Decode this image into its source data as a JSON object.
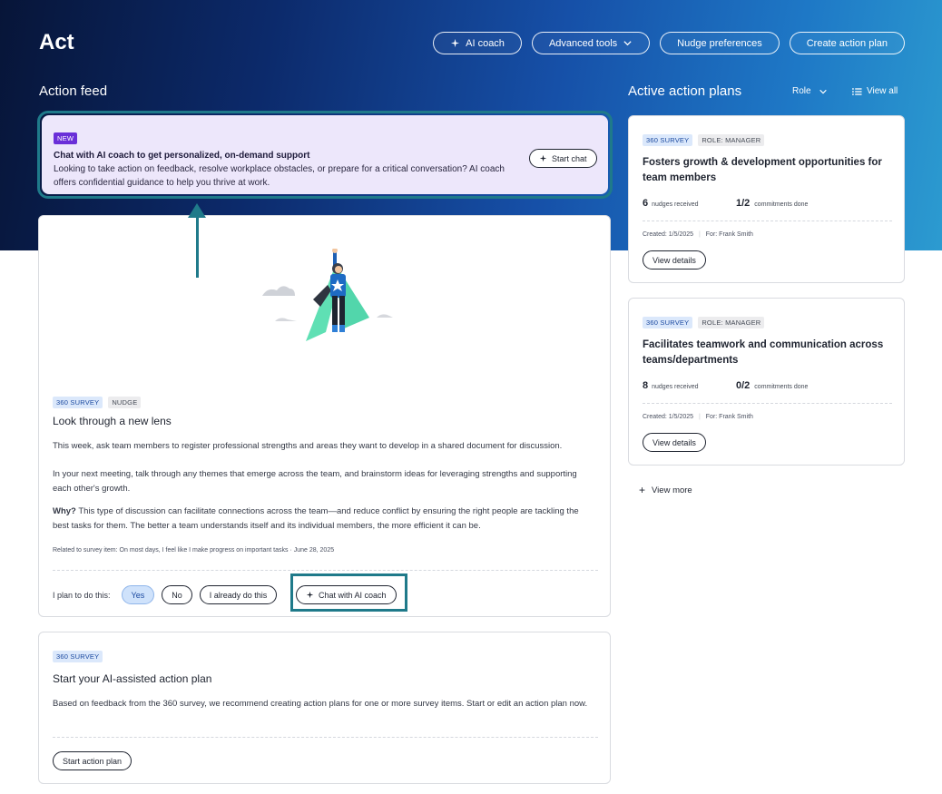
{
  "header": {
    "title": "Act",
    "actions": {
      "ai_coach": "AI coach",
      "advanced_tools": "Advanced tools",
      "nudge_preferences": "Nudge preferences",
      "create_action_plan": "Create action plan"
    }
  },
  "feed": {
    "heading": "Action feed",
    "promo": {
      "badge": "NEW",
      "title": "Chat with AI coach to get personalized, on-demand support",
      "body": "Looking to take action on feedback, resolve workplace obstacles, or prepare for a critical conversation? AI coach offers confidential guidance to help you thrive at work.",
      "button": "Start chat"
    },
    "nudge": {
      "tags": [
        "360 SURVEY",
        "NUDGE"
      ],
      "title": "Look through a new lens",
      "para1": "This week, ask team members to register professional strengths and areas they want to develop in a shared document for discussion.",
      "para2": "In your next meeting, talk through any themes that emerge across the team, and brainstorm ideas for leveraging strengths and supporting each other's growth.",
      "why_label": "Why?",
      "why_text": " This type of discussion can facilitate connections across the team—and reduce conflict by ensuring the right people are tackling the best tasks for them. The better a team understands itself and its individual members, the more efficient it can be.",
      "related": "Related to survey item: On most days, I feel like I make progress on important tasks",
      "date": "June 28, 2025",
      "plan_label": "I plan to do this:",
      "options": [
        "Yes",
        "No",
        "I already do this"
      ],
      "chat_button": "Chat with AI coach"
    },
    "ai_plan": {
      "tag": "360 SURVEY",
      "title": "Start your AI-assisted action plan",
      "body": "Based on feedback from the 360 survey, we recommend creating action plans for one or more survey items. Start or edit an action plan now.",
      "button": "Start action plan"
    }
  },
  "plans": {
    "heading": "Active action plans",
    "role_filter": "Role",
    "view_all": "View all",
    "items": [
      {
        "tags": [
          "360 SURVEY",
          "ROLE: MANAGER"
        ],
        "title": "Fosters growth & development opportunities for team members",
        "nudges": "6",
        "nudges_label": "nudges received",
        "commitments": "1/2",
        "commitments_label": "commitments done",
        "created": "Created: 1/5/2025",
        "for": "For: Frank Smith",
        "button": "View details"
      },
      {
        "tags": [
          "360 SURVEY",
          "ROLE: MANAGER"
        ],
        "title": "Facilitates teamwork and communication across teams/departments",
        "nudges": "8",
        "nudges_label": "nudges received",
        "commitments": "0/2",
        "commitments_label": "commitments done",
        "created": "Created: 1/5/2025",
        "for": "For: Frank Smith",
        "button": "View details"
      }
    ],
    "view_more": "View more"
  },
  "colors": {
    "accent_teal": "#1f7a8a",
    "new_badge": "#6a2fd8",
    "promo_bg": "#ede7fb",
    "yes_selected": "#cfe2fb"
  }
}
